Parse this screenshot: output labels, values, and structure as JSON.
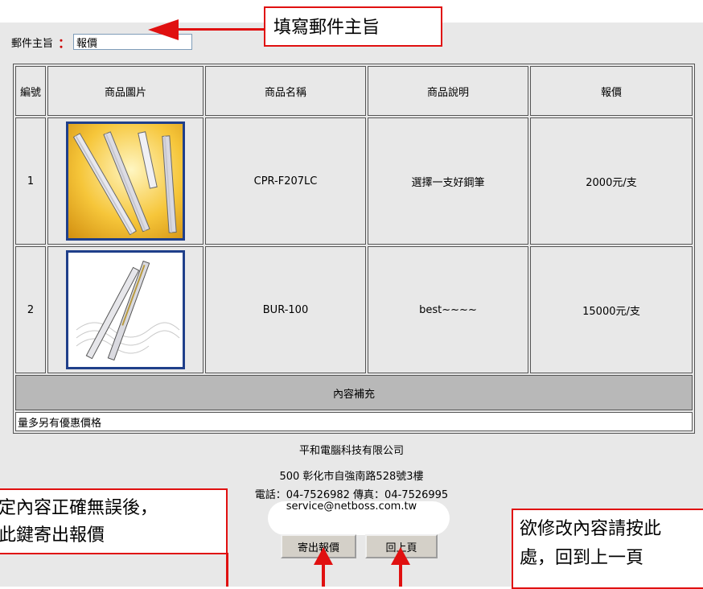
{
  "form": {
    "subject_label": "郵件主旨",
    "subject_colon": "：",
    "subject_value": "報價"
  },
  "table": {
    "headers": [
      "編號",
      "商品圖片",
      "商品名稱",
      "商品說明",
      "報價"
    ],
    "rows": [
      {
        "no": "1",
        "image": "gold-pens-image",
        "name": "CPR-F207LC",
        "desc": "選擇一支好鋼筆",
        "price": "2000元/支"
      },
      {
        "no": "2",
        "image": "silver-pen-image",
        "name": "BUR-100",
        "desc": "best~~~~",
        "price": "15000元/支"
      }
    ],
    "supplement_header": "內容補充",
    "supplement_text": "量多另有優惠價格"
  },
  "company": {
    "name": "平和電腦科技有限公司",
    "address": "500 彰化市自強南路528號3樓",
    "phone": "電話：04-7526982 傳真：04-7526995",
    "email": "service@netboss.com.tw"
  },
  "buttons": {
    "send": "寄出報價",
    "back": "回上頁"
  },
  "annotations": {
    "subject_tip": "填寫郵件主旨",
    "send_tip_line1": "定內容正確無誤後，",
    "send_tip_line2": "此鍵寄出報價",
    "back_tip_line1": "欲修改內容請按此",
    "back_tip_line2": "處，回到上一頁"
  },
  "colors": {
    "annotation_red": "#e01010",
    "form_background": "#e8e8e8",
    "supplement_header_bg": "#b8b8b8"
  }
}
